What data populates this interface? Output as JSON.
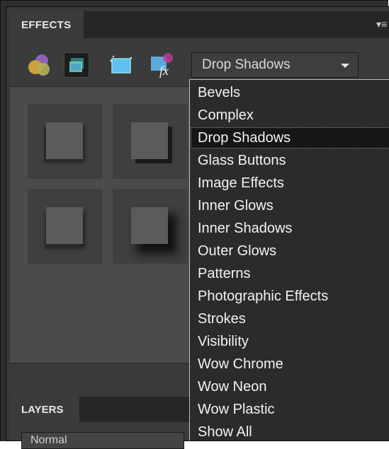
{
  "effects_panel": {
    "tab_label": "EFFECTS",
    "menu_icon": "panel-menu-icon",
    "toolbar": {
      "tools": [
        {
          "name": "photo-effects-icon"
        },
        {
          "name": "layer-styles-icon",
          "active": true
        },
        {
          "name": "filters-icon"
        },
        {
          "name": "fx-icon"
        }
      ],
      "category_select": {
        "value": "Drop Shadows"
      }
    }
  },
  "dropdown": {
    "options": [
      "Bevels",
      "Complex",
      "Drop Shadows",
      "Glass Buttons",
      "Image Effects",
      "Inner Glows",
      "Inner Shadows",
      "Outer Glows",
      "Patterns",
      "Photographic Effects",
      "Strokes",
      "Visibility",
      "Wow Chrome",
      "Wow Neon",
      "Wow Plastic",
      "Show All"
    ],
    "selected": "Drop Shadows"
  },
  "layers_panel": {
    "tab_label": "LAYERS",
    "blend_mode": "Normal"
  }
}
